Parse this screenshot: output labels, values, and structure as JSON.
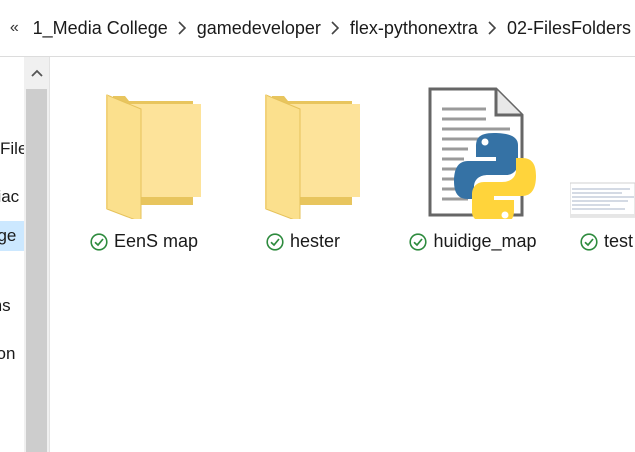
{
  "breadcrumb": {
    "overflow": "«",
    "items": [
      "1_Media College",
      "gamedeveloper",
      "flex-pythonextra",
      "02-FilesFolders"
    ]
  },
  "nav": {
    "items": [
      {
        "label": "File"
      },
      {
        "label": "diac"
      },
      {
        "label": "ege"
      },
      {
        "label": "ms"
      },
      {
        "label": "son"
      },
      {
        "label": "n"
      }
    ]
  },
  "files": [
    {
      "name": "EenS map",
      "type": "folder",
      "status": "synced"
    },
    {
      "name": "hester",
      "type": "folder",
      "status": "synced"
    },
    {
      "name": "huidige_map",
      "type": "python-file",
      "status": "synced"
    },
    {
      "name": "test",
      "type": "text-file",
      "status": "synced"
    }
  ],
  "colors": {
    "folder_back": "#e8c55e",
    "folder_front": "#fde39a",
    "sync_green": "#2e8b3e",
    "selection": "#cce8ff",
    "python_blue": "#3572a5",
    "python_yellow": "#ffd43b"
  }
}
